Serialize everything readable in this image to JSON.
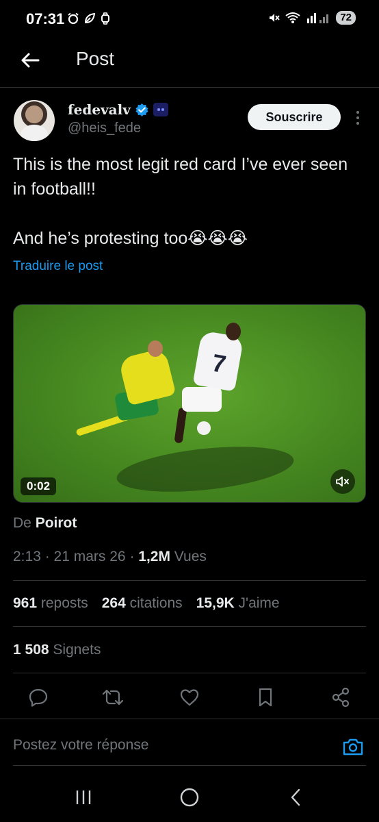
{
  "status_bar": {
    "time": "07:31",
    "battery": "72"
  },
  "header": {
    "title": "Post"
  },
  "author": {
    "name": "fedevalv",
    "handle": "@heis_fede",
    "subscribe_label": "Souscrire"
  },
  "post": {
    "line1": "This is the most legit red card I’ve ever seen in football!!",
    "line2": "And he’s protesting too😭😭😭",
    "translate_label": "Traduire le post"
  },
  "video": {
    "duration": "0:02",
    "player_number": "7"
  },
  "attribution": {
    "prefix": "De",
    "name": "Poirot"
  },
  "meta": {
    "time": "2:13",
    "sep1": " · ",
    "date": "21 mars 26",
    "sep2": " · ",
    "views_value": "1,2M",
    "views_label": " Vues"
  },
  "stats": {
    "reposts_value": "961",
    "reposts_label": " reposts",
    "quotes_value": "264",
    "quotes_label": " citations",
    "likes_value": "15,9K",
    "likes_label": " J'aime",
    "bookmarks_value": "1 508",
    "bookmarks_label": " Signets"
  },
  "reply": {
    "placeholder": "Postez votre réponse"
  },
  "colors": {
    "accent": "#1d9bf0",
    "muted": "#71767b",
    "text": "#e7e9ea",
    "background": "#000000"
  }
}
